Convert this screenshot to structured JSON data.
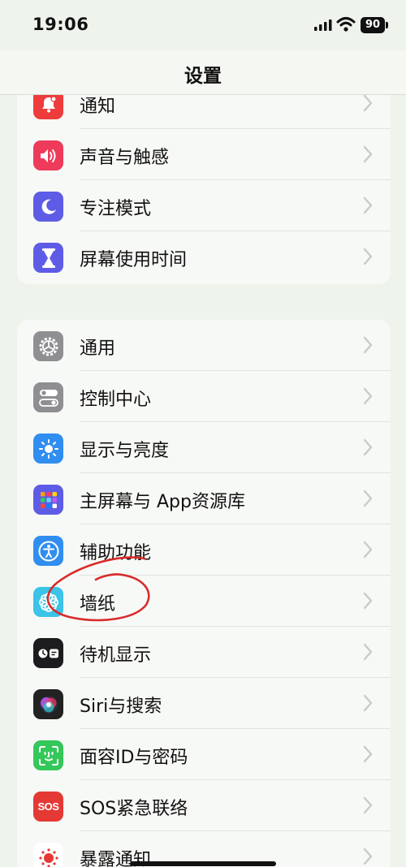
{
  "status_bar": {
    "time": "19:06",
    "battery": "90"
  },
  "header": {
    "title": "设置"
  },
  "groups": [
    {
      "items": [
        {
          "label": "通知",
          "icon": "bell-icon",
          "color": "#ee3b3b"
        },
        {
          "label": "声音与触感",
          "icon": "speaker-icon",
          "color": "#ee3b5b"
        },
        {
          "label": "专注模式",
          "icon": "moon-icon",
          "color": "#5e5ce6"
        },
        {
          "label": "屏幕使用时间",
          "icon": "hourglass-icon",
          "color": "#5e5ce6"
        }
      ]
    },
    {
      "items": [
        {
          "label": "通用",
          "icon": "gear-icon",
          "color": "#8e8e93"
        },
        {
          "label": "控制中心",
          "icon": "toggles-icon",
          "color": "#8e8e93"
        },
        {
          "label": "显示与亮度",
          "icon": "sun-icon",
          "color": "#2f8ef0"
        },
        {
          "label": "主屏幕与 App资源库",
          "icon": "app-grid-icon",
          "color": "#5e5ce6"
        },
        {
          "label": "辅助功能",
          "icon": "accessibility-icon",
          "color": "#2f8ef0"
        },
        {
          "label": "墙纸",
          "icon": "flower-icon",
          "color": "#3bc3e8"
        },
        {
          "label": "待机显示",
          "icon": "standby-icon",
          "color": "#1c1c1e"
        },
        {
          "label": "Siri与搜索",
          "icon": "siri-icon",
          "color": "#222222"
        },
        {
          "label": "面容ID与密码",
          "icon": "face-id-icon",
          "color": "#34c759"
        },
        {
          "label": "SOS紧急联络",
          "icon": "sos-icon",
          "color": "#e53935"
        },
        {
          "label": "暴露通知",
          "icon": "exposure-icon",
          "color": "#ffffff"
        }
      ]
    }
  ],
  "icon_text": {
    "sos": "SOS"
  },
  "annotation": {
    "color": "#d92a2a",
    "target": "墙纸"
  }
}
